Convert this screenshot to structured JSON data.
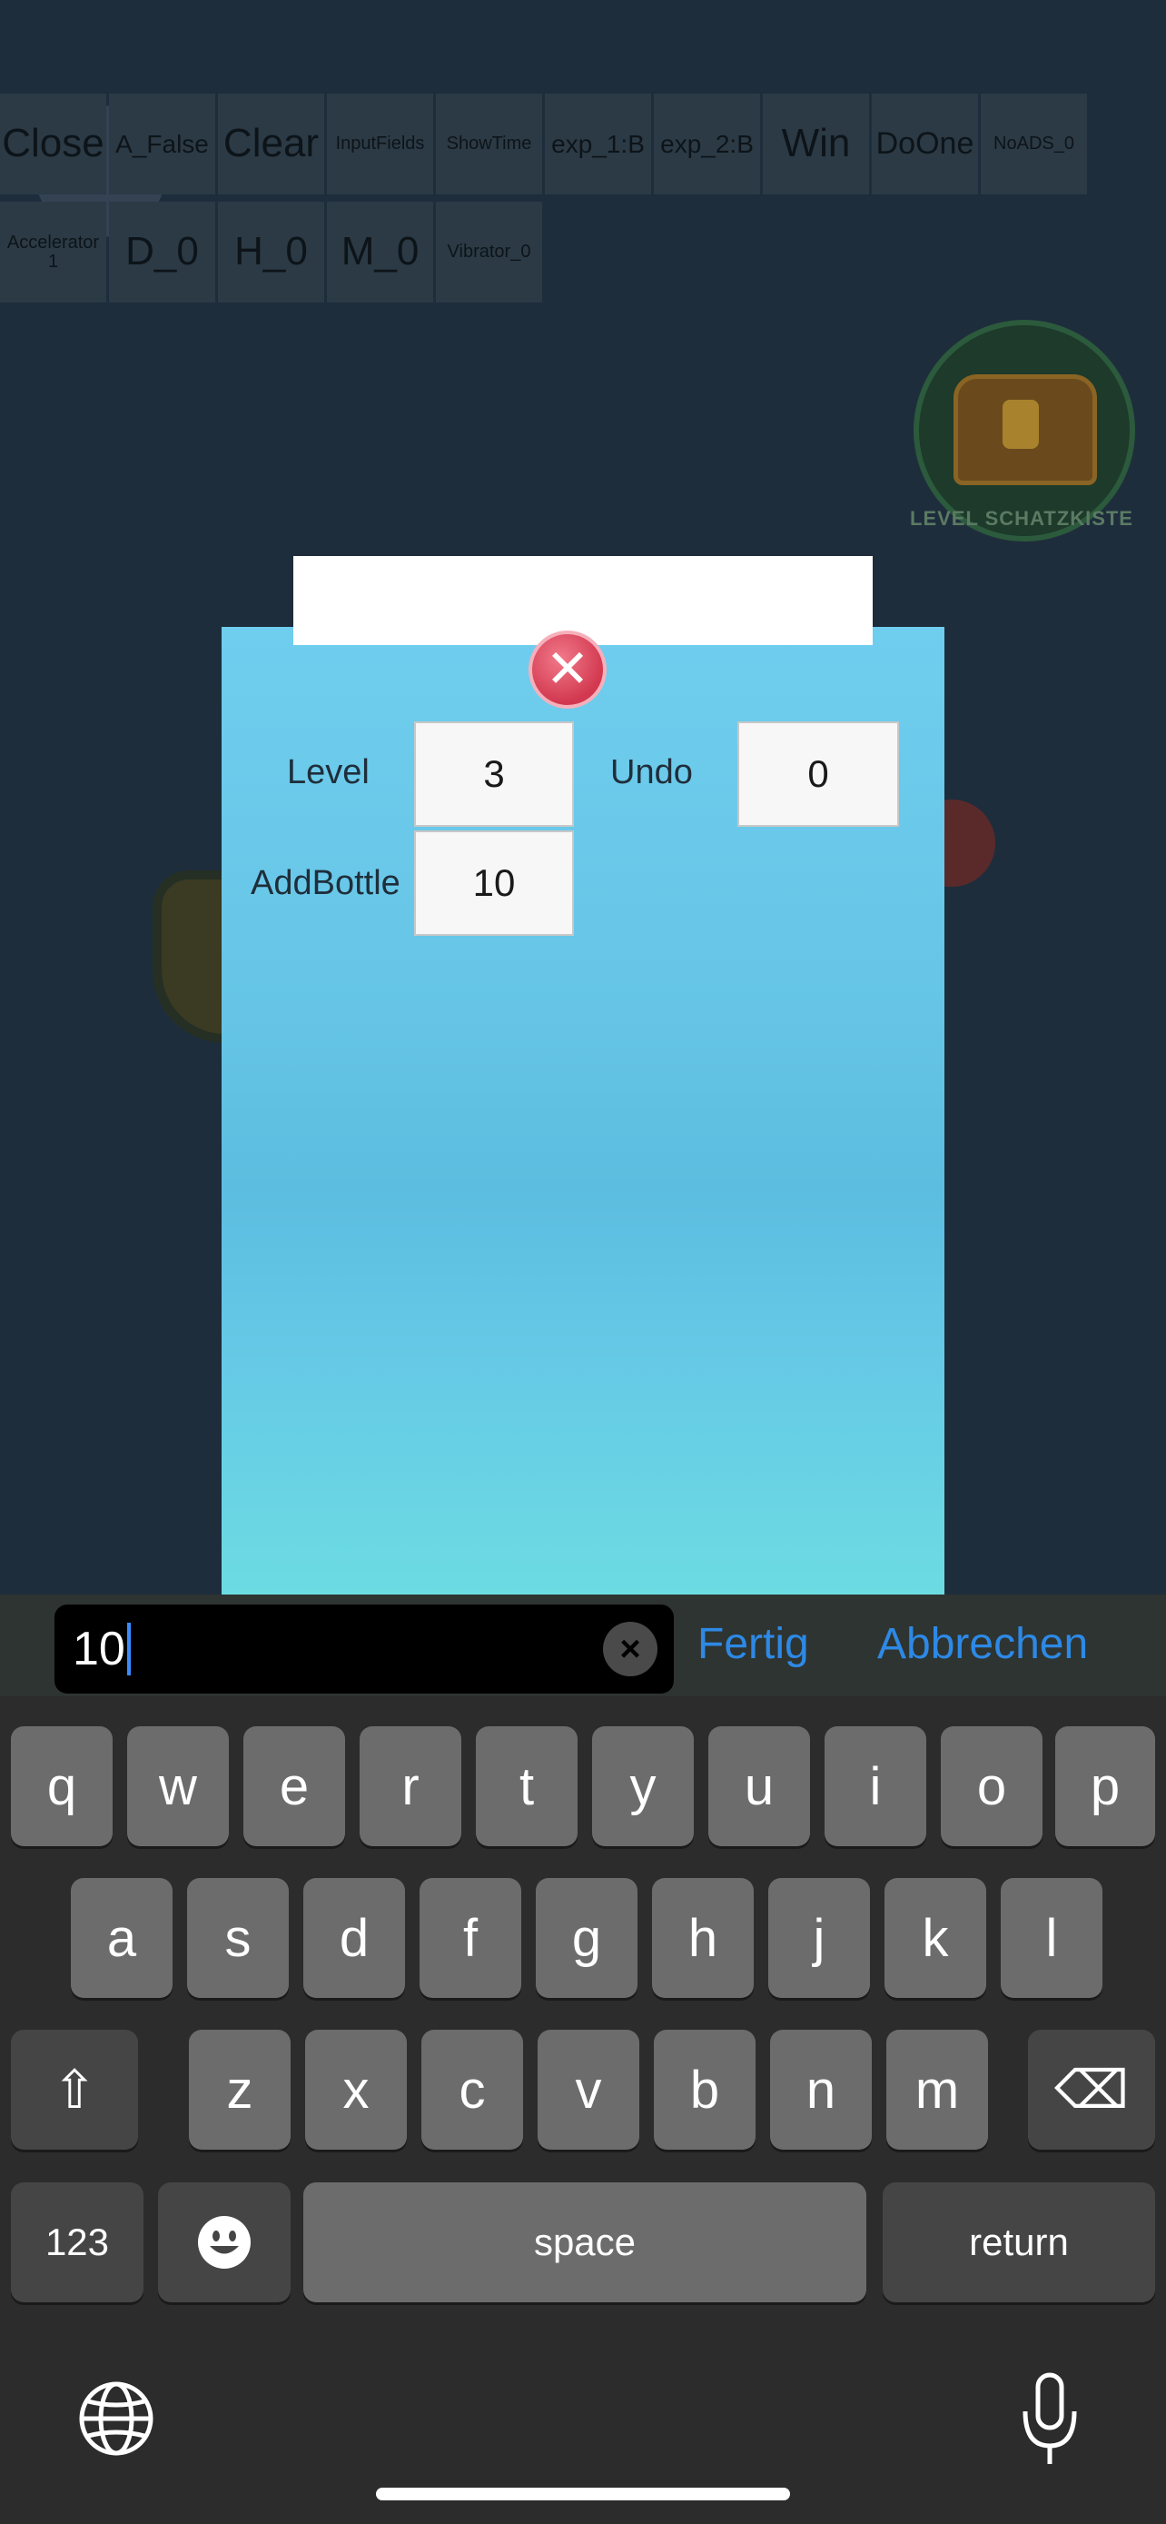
{
  "debug_menu": {
    "row1": [
      "Close",
      "A_False",
      "Clear",
      "InputFields",
      "ShowTime",
      "exp_1:B",
      "exp_2:B",
      "Win",
      "DoOne",
      "NoADS_0"
    ],
    "row2": [
      "Accelerator 1",
      "D_0",
      "H_0",
      "M_0",
      "Vibrator_0"
    ]
  },
  "chest_label": "LEVEL SCHATZKISTE",
  "panel": {
    "level_label": "Level",
    "level_value": "3",
    "undo_label": "Undo",
    "undo_value": "0",
    "addbottle_label": "AddBottle",
    "addbottle_value": "10"
  },
  "input_bar": {
    "text_value": "10",
    "done_label": "Fertig",
    "cancel_label": "Abbrechen"
  },
  "keyboard": {
    "row1": [
      "q",
      "w",
      "e",
      "r",
      "t",
      "y",
      "u",
      "i",
      "o",
      "p"
    ],
    "row2": [
      "a",
      "s",
      "d",
      "f",
      "g",
      "h",
      "j",
      "k",
      "l"
    ],
    "row3": [
      "z",
      "x",
      "c",
      "v",
      "b",
      "n",
      "m"
    ],
    "numbers_key": "123",
    "space_key": "space",
    "return_key": "return"
  },
  "colors": {
    "panel_blue": "#66c5e6",
    "accent_blue": "#2d89e6",
    "close_red": "#d2384f"
  },
  "icons": [
    "close-x-icon",
    "clear-text-icon",
    "shift-icon",
    "backspace-icon",
    "emoji-icon",
    "globe-icon",
    "microphone-icon"
  ]
}
